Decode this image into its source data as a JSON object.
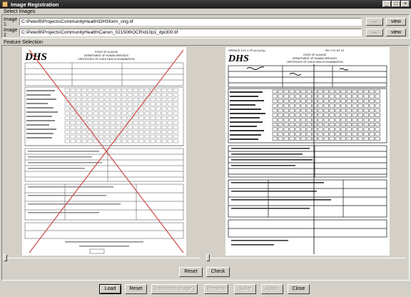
{
  "window": {
    "title": "Image Registration",
    "controls": [
      "_",
      "□",
      "×"
    ]
  },
  "select_images": {
    "label": "Select Images",
    "image1": {
      "label": "Image 1",
      "path": "C:\\PeterB\\Projects\\CommunityHealth\\DHSform_orig.tif",
      "browse_label": "...",
      "view_label": "view"
    },
    "image2": {
      "label": "Image 2",
      "path": "C:\\PeterB\\Projects\\CommunityHealth\\Canon_021506\\OCR\\d10p1_dpi300.tif",
      "browse_label": "...",
      "view_label": "view"
    }
  },
  "feature_selection": {
    "label": "Feature Selection",
    "left_doc": {
      "logo": "DHS",
      "lines": [
        "STATE OF ILLINOIS",
        "DEPARTMENT OF HUMAN SERVICES",
        "CERTIFICATE OF CHILD HEALTH EXAMINATION"
      ]
    },
    "right_doc": {
      "logo": "DHS",
      "header": "SPENCE 1C1 1 1P  dd.1uJ1p",
      "header_right": "RK  YTX NT 12",
      "lines": [
        "STATE OF ILLINOIS",
        "DEPARTMENT OF HUMAN SERVICES",
        "CERTIFICATE OF CHILD HEALTH EXAMINATION"
      ]
    },
    "left_slider_value": 0.0,
    "right_slider_value": 0.0,
    "reset_label": "Reset",
    "check_label": "Check"
  },
  "bottom_buttons": {
    "load": "Load",
    "reset": "Reset",
    "transform": "Transform Image 2",
    "preview": "Preview",
    "save": "Save",
    "apply": "Apply",
    "close": "Close"
  }
}
